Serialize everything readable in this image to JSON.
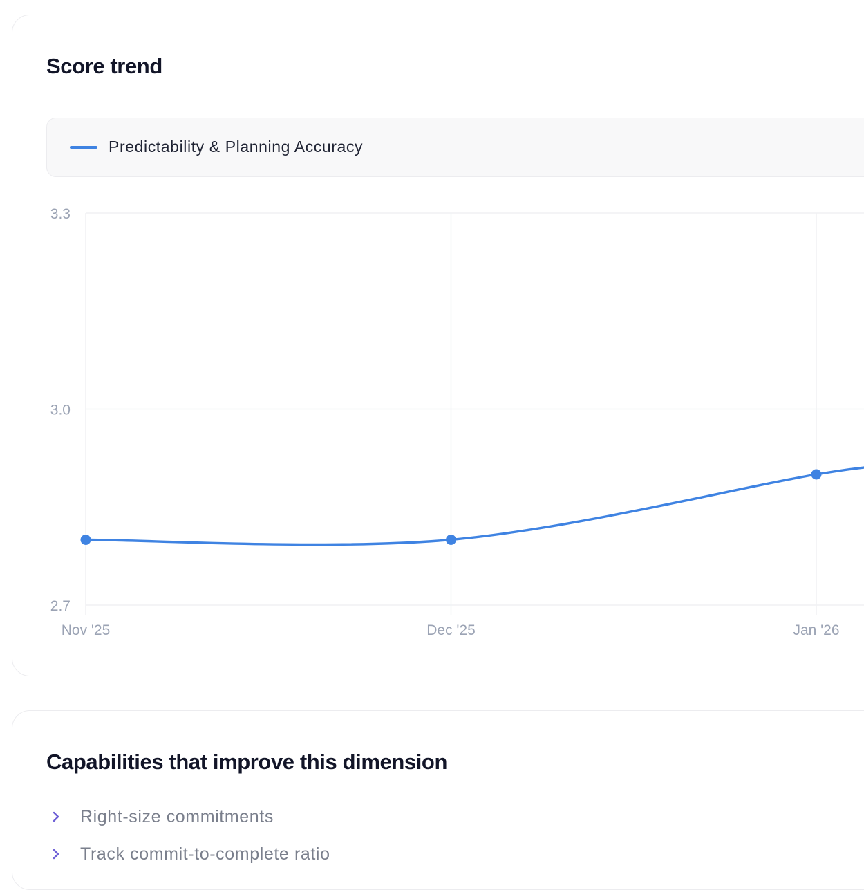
{
  "score_trend": {
    "title": "Score trend",
    "legend_label": "Predictability & Planning Accuracy"
  },
  "chart_data": {
    "type": "line",
    "title": "",
    "xlabel": "",
    "ylabel": "",
    "categories": [
      "Nov '25",
      "Dec '25",
      "Jan '26"
    ],
    "y_ticks": [
      "3.3",
      "3.0",
      "2.7"
    ],
    "ylim": [
      2.7,
      3.3
    ],
    "grid": true,
    "legend_placement": "top",
    "series": [
      {
        "name": "Predictability & Planning Accuracy",
        "color": "#3f83e2",
        "values": [
          2.8,
          2.8,
          2.9
        ]
      }
    ]
  },
  "capabilities": {
    "title": "Capabilities that improve this dimension",
    "icon": "chevron-right-icon",
    "icon_color": "#6d5fd6",
    "items": [
      {
        "label": "Right-size commitments"
      },
      {
        "label": "Track commit-to-complete ratio"
      }
    ]
  }
}
